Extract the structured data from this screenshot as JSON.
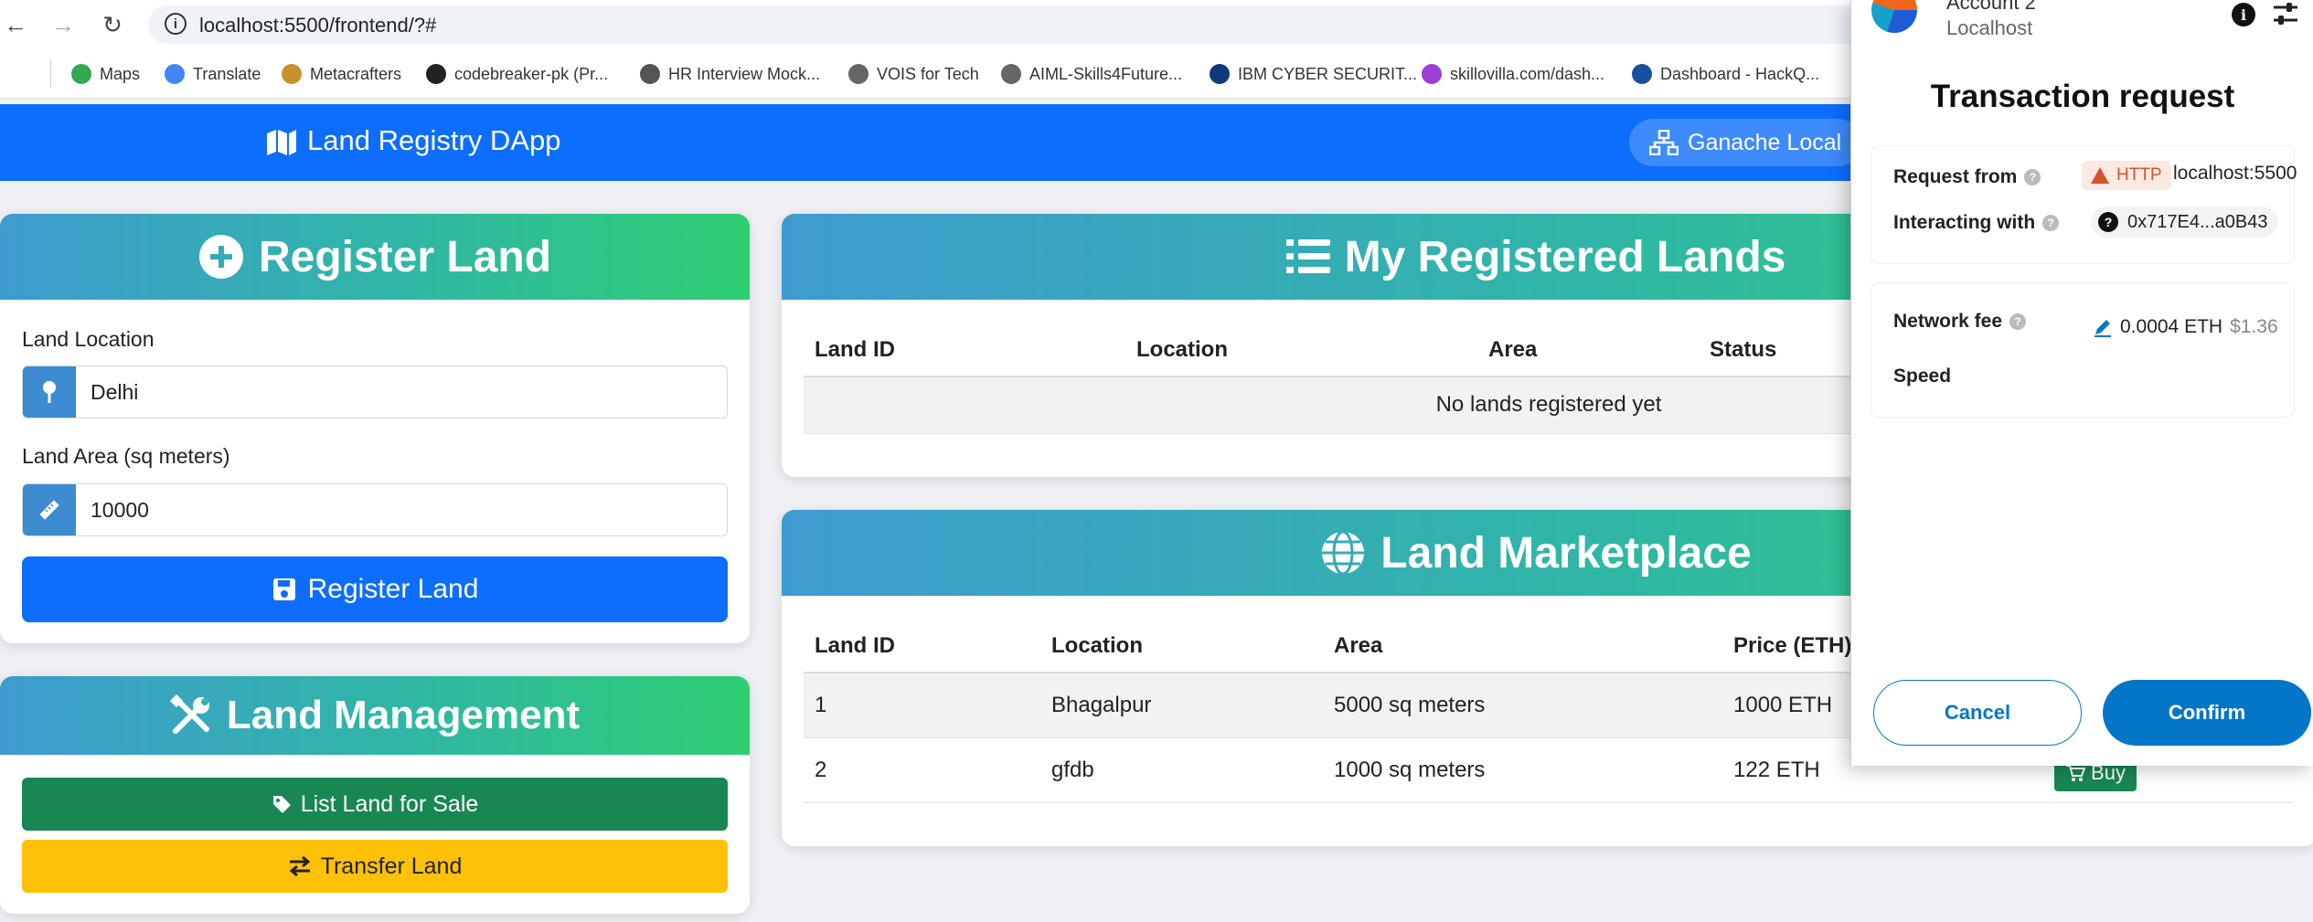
{
  "browser": {
    "url": "localhost:5500/frontend/?#",
    "bookmarks": [
      {
        "label": "Maps",
        "icon": "maps-icon",
        "color": "#34a853"
      },
      {
        "label": "Translate",
        "icon": "translate-icon",
        "color": "#4285f4"
      },
      {
        "label": "Metacrafters",
        "icon": "metacrafters-icon",
        "color": "#c8922a"
      },
      {
        "label": "codebreaker-pk (Pr...",
        "icon": "github-icon",
        "color": "#222222"
      },
      {
        "label": "HR Interview Mock...",
        "icon": "openai-icon",
        "color": "#555555"
      },
      {
        "label": "VOIS for Tech",
        "icon": "globe-icon",
        "color": "#666666"
      },
      {
        "label": "AIML-Skills4Future...",
        "icon": "globe-icon",
        "color": "#666666"
      },
      {
        "label": "IBM CYBER SECURIT...",
        "icon": "yl-icon",
        "color": "#0f3a7a"
      },
      {
        "label": "skillovilla.com/dash...",
        "icon": "skillovilla-icon",
        "color": "#9b3fd6"
      },
      {
        "label": "Dashboard - HackQ...",
        "icon": "tata-icon",
        "color": "#1a4fa0"
      }
    ]
  },
  "navbar": {
    "brand": "Land Registry DApp",
    "network": "Ganache Local"
  },
  "register": {
    "title": "Register Land",
    "location_label": "Land Location",
    "location_value": "Delhi",
    "area_label": "Land Area (sq meters)",
    "area_value": "10000",
    "submit_label": "Register Land"
  },
  "management": {
    "title": "Land Management",
    "list_label": "List Land for Sale",
    "transfer_label": "Transfer Land"
  },
  "my_lands": {
    "title": "My Registered Lands",
    "columns": [
      "Land ID",
      "Location",
      "Area",
      "Status"
    ],
    "empty_message": "No lands registered yet"
  },
  "marketplace": {
    "title": "Land Marketplace",
    "columns": [
      "Land ID",
      "Location",
      "Area",
      "Price (ETH)"
    ],
    "rows": [
      {
        "id": "1",
        "location": "Bhagalpur",
        "area": "5000 sq meters",
        "price": "1000 ETH"
      },
      {
        "id": "2",
        "location": "gfdb",
        "area": "1000 sq meters",
        "price": "122 ETH"
      }
    ],
    "buy_label": "Buy"
  },
  "metamask": {
    "account": "Account 2",
    "host": "Localhost",
    "title": "Transaction request",
    "request_from_label": "Request from",
    "http_badge": "HTTP",
    "request_host": "localhost:5500",
    "interacting_label": "Interacting with",
    "contract_address": "0x717E4...a0B43",
    "network_fee_label": "Network fee",
    "fee_eth": "0.0004 ETH",
    "fee_usd": "$1.36",
    "speed_label": "Speed",
    "cancel_label": "Cancel",
    "confirm_label": "Confirm"
  },
  "colors": {
    "primary": "#0d6efd",
    "success": "#198754",
    "warning": "#ffc107",
    "metamask_blue": "#0376c9"
  }
}
